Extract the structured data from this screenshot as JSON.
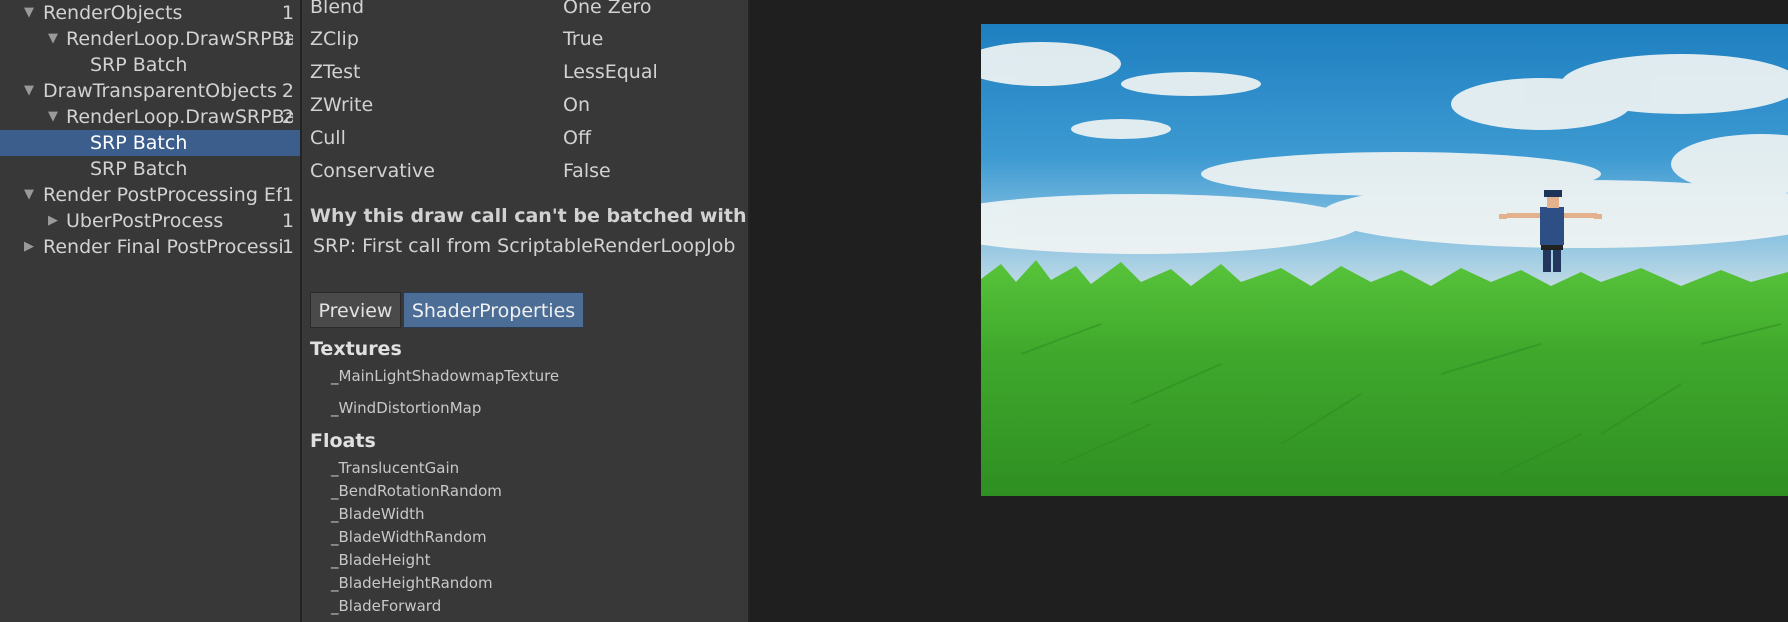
{
  "tree": {
    "rows": [
      {
        "label": "RenderObjects",
        "count": "1",
        "expanded": true
      },
      {
        "label": "RenderLoop.DrawSRPBatcher",
        "count": "1",
        "expanded": true
      },
      {
        "label": "SRP Batch",
        "count": ""
      },
      {
        "label": "DrawTransparentObjects",
        "count": "2",
        "expanded": true
      },
      {
        "label": "RenderLoop.DrawSRPBatcher",
        "count": "2",
        "expanded": true
      },
      {
        "label": "SRP Batch",
        "count": "",
        "selected": true
      },
      {
        "label": "SRP Batch",
        "count": ""
      },
      {
        "label": "Render PostProcessing Effects",
        "count": "1",
        "expanded": true
      },
      {
        "label": "UberPostProcess",
        "count": "1",
        "expanded": false
      },
      {
        "label": "Render Final PostProcessing",
        "count": "1",
        "expanded": false
      }
    ]
  },
  "inspector": {
    "state": [
      {
        "key": "Blend",
        "value": "One Zero"
      },
      {
        "key": "ZClip",
        "value": "True"
      },
      {
        "key": "ZTest",
        "value": "LessEqual"
      },
      {
        "key": "ZWrite",
        "value": "On"
      },
      {
        "key": "Cull",
        "value": "Off"
      },
      {
        "key": "Conservative",
        "value": "False"
      }
    ],
    "why_heading": "Why this draw call can't be batched with the",
    "why_text": "SRP: First call from ScriptableRenderLoopJob",
    "tabs": [
      {
        "label": "Preview",
        "active": false
      },
      {
        "label": "ShaderProperties",
        "active": true
      }
    ],
    "textures_title": "Textures",
    "textures": [
      "_MainLightShadowmapTexture",
      "_WindDistortionMap"
    ],
    "floats_title": "Floats",
    "floats": [
      "_TranslucentGain",
      "_BendRotationRandom",
      "_BladeWidth",
      "_BladeWidthRandom",
      "_BladeHeight",
      "_BladeHeightRandom",
      "_BladeForward"
    ]
  },
  "colors": {
    "panel": "#383838",
    "selection": "#3b5e8c",
    "tab_active": "#4c6d96",
    "sky": "#2a87c6",
    "grass": "#3fa82c"
  }
}
